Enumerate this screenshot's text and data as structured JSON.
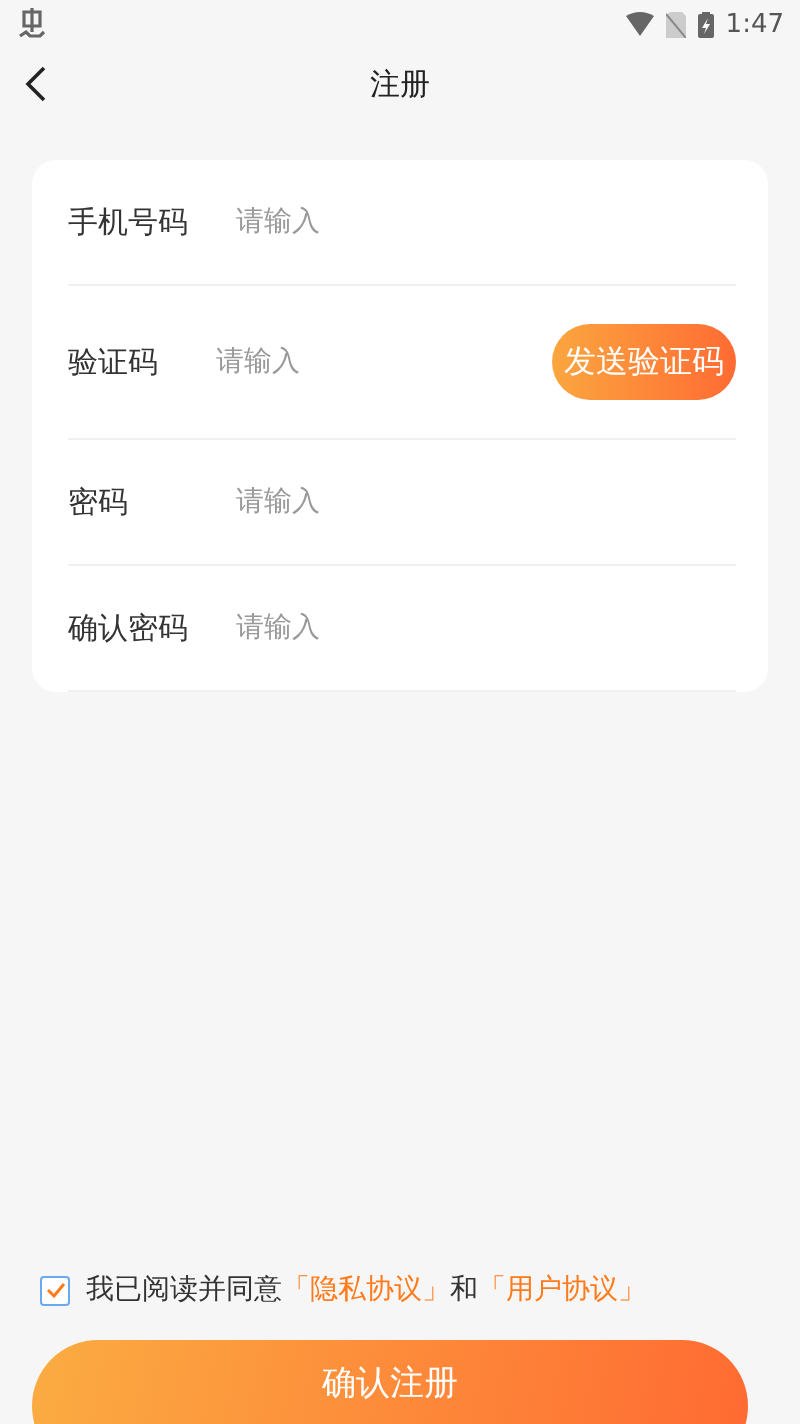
{
  "status_bar": {
    "time": "1:47"
  },
  "header": {
    "title": "注册"
  },
  "form": {
    "fields": [
      {
        "kind": "text",
        "label": "手机号码",
        "placeholder": "请输入"
      },
      {
        "kind": "code",
        "label": "验证码",
        "placeholder": "请输入",
        "button": "发送验证码"
      },
      {
        "kind": "text",
        "label": "密码",
        "placeholder": "请输入"
      },
      {
        "kind": "text",
        "label": "确认密码",
        "placeholder": "请输入"
      }
    ]
  },
  "agreement": {
    "checked": true,
    "text": "我已阅读并同意",
    "links": [
      "「隐私协议」",
      "「用户协议」"
    ],
    "joiner": "和"
  },
  "submit": {
    "label": "确认注册"
  }
}
